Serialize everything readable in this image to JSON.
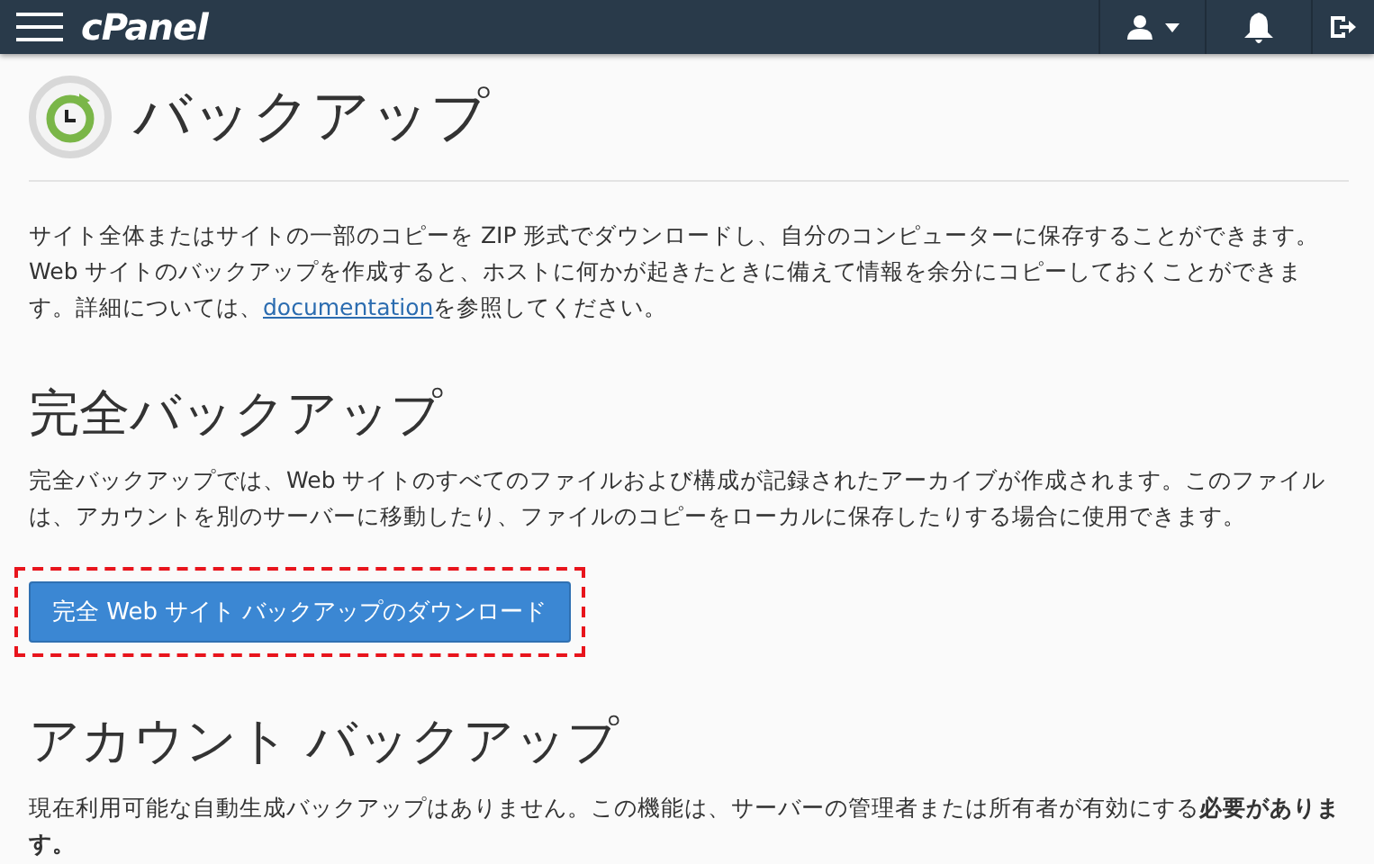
{
  "header": {
    "logo": "cPanel"
  },
  "page": {
    "title": "バックアップ",
    "intro": {
      "before": "サイト全体またはサイトの一部のコピーを ZIP 形式でダウンロードし、自分のコンピューターに保存することができます。Web サイトのバックアップを作成すると、ホストに何かが起きたときに備えて情報を余分にコピーしておくことができます。詳細については、",
      "link": "documentation",
      "after": "を参照してください。"
    }
  },
  "sections": [
    {
      "heading": "完全バックアップ",
      "text": "完全バックアップでは、Web サイトのすべてのファイルおよび構成が記録されたアーカイブが作成されます。このファイルは、アカウントを別のサーバーに移動したり、ファイルのコピーをローカルに保存したりする場合に使用できます。",
      "button": {
        "label": "完全 Web サイト バックアップのダウンロード",
        "highlighted": true
      }
    },
    {
      "heading": "アカウント バックアップ",
      "text": "現在利用可能な自動生成バックアップはありません。この機能は、サーバーの管理者または所有者が有効にする**必要があります。**"
    }
  ]
}
